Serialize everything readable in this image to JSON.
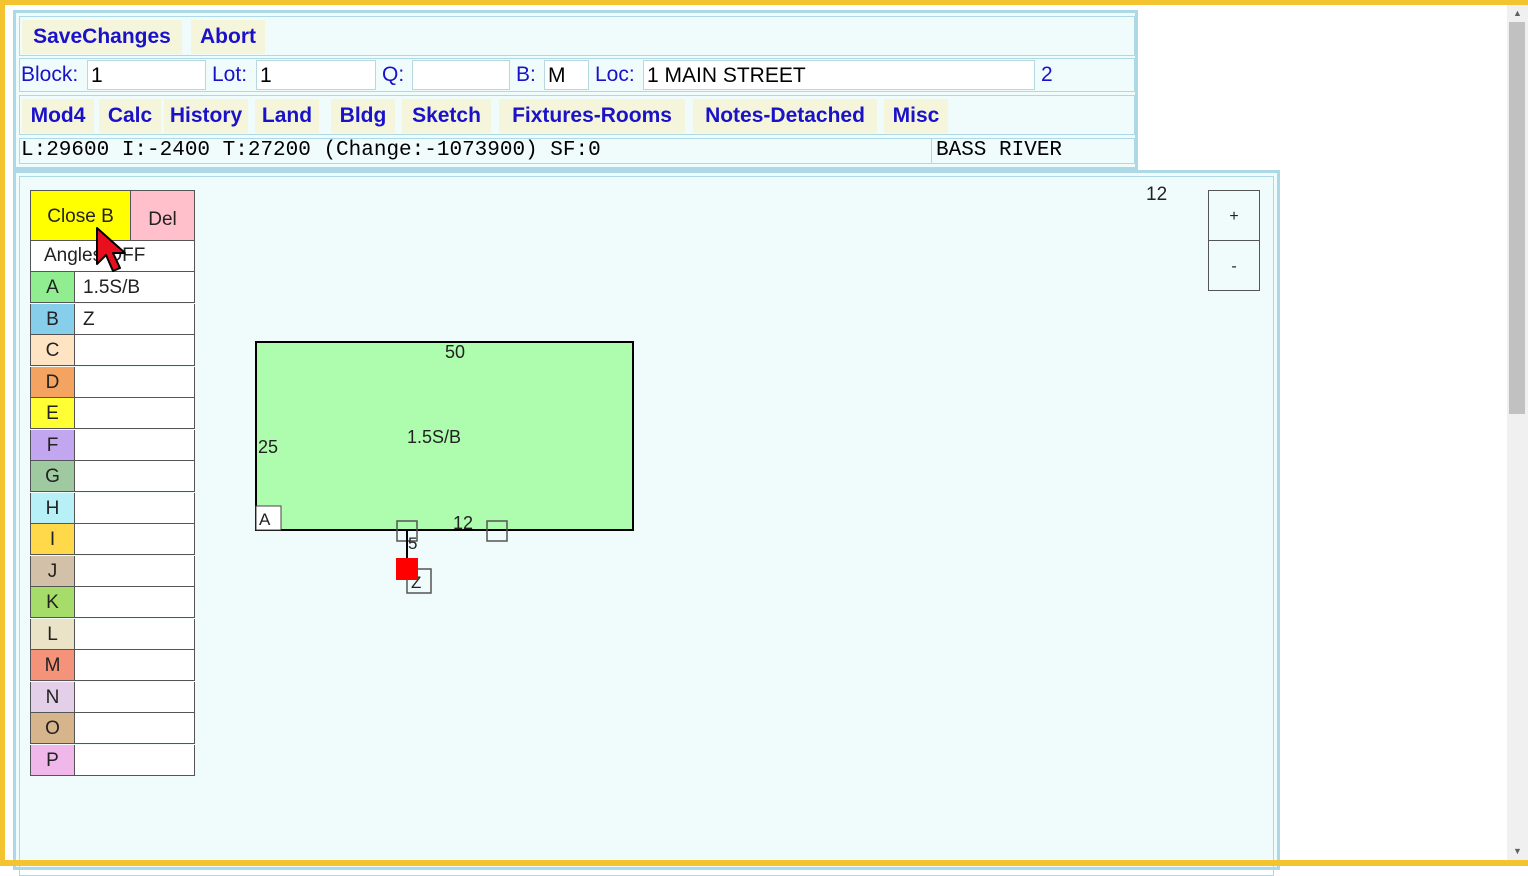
{
  "toolbar": {
    "save_label": "SaveChanges",
    "abort_label": "Abort"
  },
  "record": {
    "block_label": "Block:",
    "block_value": "1",
    "lot_label": "Lot:",
    "lot_value": "1",
    "q_label": "Q:",
    "q_value": "",
    "b_label": "B:",
    "b_value": "M",
    "loc_label": "Loc:",
    "loc_value": "1 MAIN STREET",
    "card_number": "2"
  },
  "tabs": [
    {
      "label": "Mod4"
    },
    {
      "label": "Calc"
    },
    {
      "label": "History"
    },
    {
      "label": "Land"
    },
    {
      "label": "Bldg"
    },
    {
      "label": "Sketch"
    },
    {
      "label": "Fixtures-Rooms"
    },
    {
      "label": "Notes-Detached"
    },
    {
      "label": "Misc"
    }
  ],
  "status": {
    "values": "L:29600 I:-2400 T:27200 (Change:-1073900) SF:0",
    "town": "BASS RIVER"
  },
  "sketch": {
    "close_label": "Close B",
    "del_label": "Del",
    "angles_label": "Angles OFF",
    "zoom_level": "12",
    "zoom_in": "+",
    "zoom_out": "-",
    "areas": [
      {
        "letter": "A",
        "value": "1.5S/B",
        "color": "#90ee90"
      },
      {
        "letter": "B",
        "value": "Z",
        "color": "#87ceeb"
      },
      {
        "letter": "C",
        "value": "",
        "color": "#ffe4c4"
      },
      {
        "letter": "D",
        "value": "",
        "color": "#f4a460"
      },
      {
        "letter": "E",
        "value": "",
        "color": "#ffff33"
      },
      {
        "letter": "F",
        "value": "",
        "color": "#c3a6f0"
      },
      {
        "letter": "G",
        "value": "",
        "color": "#9fc9a0"
      },
      {
        "letter": "H",
        "value": "",
        "color": "#b8f0f8"
      },
      {
        "letter": "I",
        "value": "",
        "color": "#ffd94a"
      },
      {
        "letter": "J",
        "value": "",
        "color": "#d2c0a8"
      },
      {
        "letter": "K",
        "value": "",
        "color": "#a6dd6a"
      },
      {
        "letter": "L",
        "value": "",
        "color": "#ebe3c8"
      },
      {
        "letter": "M",
        "value": "",
        "color": "#f4937a"
      },
      {
        "letter": "N",
        "value": "",
        "color": "#e3cfe8"
      },
      {
        "letter": "O",
        "value": "",
        "color": "#d6b48c"
      },
      {
        "letter": "P",
        "value": "",
        "color": "#f0b8ea"
      }
    ],
    "shape": {
      "fill": "#aefcae",
      "top_dim": "50",
      "side_dim": "25",
      "area_label": "1.5S/B",
      "corner_label": "A",
      "bottom_dim": "12",
      "stub_dim": "5",
      "marker_label": "Z",
      "active_point_color": "#ff0000"
    }
  }
}
